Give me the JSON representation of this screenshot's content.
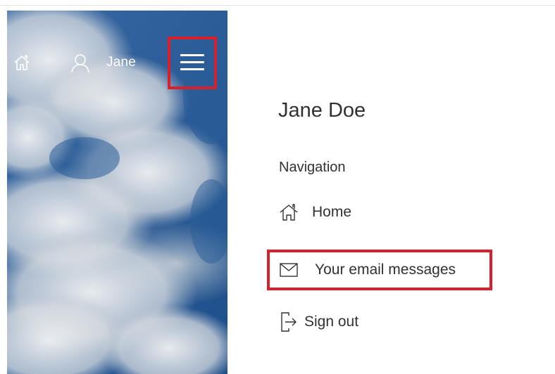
{
  "header": {
    "username": "Jane",
    "icons": {
      "home": "home-icon",
      "user": "person-icon",
      "menu": "hamburger-menu-icon"
    }
  },
  "panel": {
    "profile_name": "Jane Doe",
    "nav_heading": "Navigation",
    "items": [
      {
        "label": "Home",
        "icon": "home-icon"
      },
      {
        "label": "Your email messages",
        "icon": "envelope-icon"
      },
      {
        "label": "Sign out",
        "icon": "sign-out-icon"
      }
    ]
  },
  "colors": {
    "highlight": "#d9202a",
    "sky": "#2d5a94",
    "text": "#323130",
    "header_text": "#ffffff"
  }
}
